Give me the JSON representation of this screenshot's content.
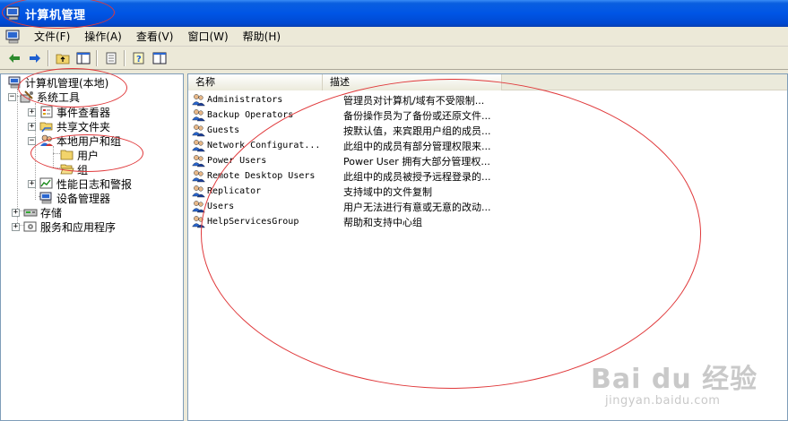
{
  "window": {
    "title": "计算机管理"
  },
  "menu": [
    {
      "label": "文件(F)"
    },
    {
      "label": "操作(A)"
    },
    {
      "label": "查看(V)"
    },
    {
      "label": "窗口(W)"
    },
    {
      "label": "帮助(H)"
    }
  ],
  "toolbar": {
    "buttons": [
      "back-arrow-icon",
      "forward-arrow-icon",
      "up-folder-icon",
      "show-hide-tree-icon",
      "export-list-icon",
      "help-icon",
      "properties-icon"
    ]
  },
  "tree": {
    "root": "计算机管理(本地)",
    "system_tools": "系统工具",
    "event_viewer": "事件查看器",
    "shared_folders": "共享文件夹",
    "local_users_groups": "本地用户和组",
    "users": "用户",
    "groups": "组",
    "perf_logs": "性能日志和警报",
    "device_manager": "设备管理器",
    "storage": "存储",
    "services_apps": "服务和应用程序"
  },
  "list": {
    "col_name": "名称",
    "col_desc": "描述",
    "rows": [
      {
        "name": "Administrators",
        "desc": "管理员对计算机/域有不受限制..."
      },
      {
        "name": "Backup Operators",
        "desc": "备份操作员为了备份或还原文件..."
      },
      {
        "name": "Guests",
        "desc": "按默认值，来宾跟用户组的成员..."
      },
      {
        "name": "Network Configurat...",
        "desc": "此组中的成员有部分管理权限来..."
      },
      {
        "name": "Power Users",
        "desc": "Power User 拥有大部分管理权..."
      },
      {
        "name": "Remote Desktop Users",
        "desc": "此组中的成员被授予远程登录的..."
      },
      {
        "name": "Replicator",
        "desc": "支持域中的文件复制"
      },
      {
        "name": "Users",
        "desc": "用户无法进行有意或无意的改动..."
      },
      {
        "name": "HelpServicesGroup",
        "desc": "帮助和支持中心组"
      }
    ]
  },
  "watermark": {
    "brand": "Bai du 经验",
    "url": "jingyan.baidu.com"
  },
  "colors": {
    "title_bar": "#0055e5",
    "annotation": "#e0393b",
    "pane_border": "#7f9db9"
  }
}
